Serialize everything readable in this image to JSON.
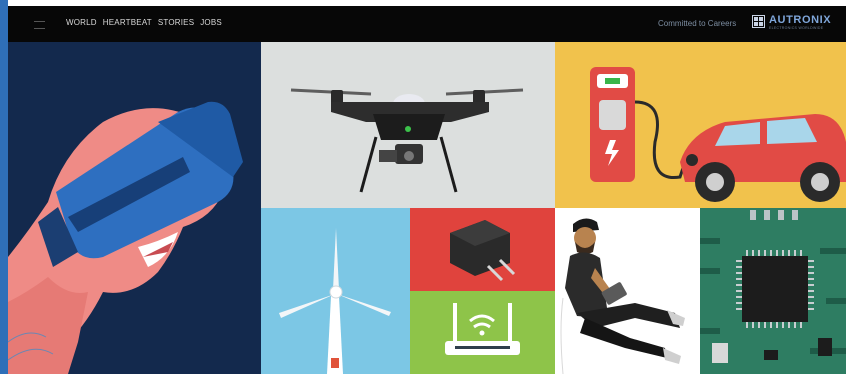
{
  "nav": {
    "items": [
      {
        "label": "WORLD"
      },
      {
        "label": "HEARTBEAT"
      },
      {
        "label": "STORIES"
      },
      {
        "label": "JOBS"
      }
    ],
    "careers": "Committed to Careers"
  },
  "logo": {
    "name": "AUTRONIX",
    "tagline": "ELECTRONICS WORLDWIDE"
  },
  "tiles": [
    {
      "name": "vr-headset-illustration",
      "icon": "vr-headset"
    },
    {
      "name": "drone-illustration",
      "icon": "drone"
    },
    {
      "name": "electric-car-charging-illustration",
      "icon": "ev-charger"
    },
    {
      "name": "wind-turbine-illustration",
      "icon": "wind-turbine"
    },
    {
      "name": "power-adapter-illustration",
      "icon": "power-adapter"
    },
    {
      "name": "wifi-router-illustration",
      "icon": "wifi-router"
    },
    {
      "name": "person-with-tablet-illustration",
      "icon": "person-reading"
    },
    {
      "name": "circuit-board-illustration",
      "icon": "microchip"
    }
  ],
  "colors": {
    "topbar": "#070707",
    "accent": "#2f6fb8",
    "vr_bg": "#13294d",
    "drone_bg": "#dcdfde",
    "car_bg": "#f1c24c",
    "wind_bg": "#7cc7e5",
    "adapter_bg": "#e0433d",
    "router_bg": "#8ec449",
    "chip_bg": "#2e7d62"
  }
}
